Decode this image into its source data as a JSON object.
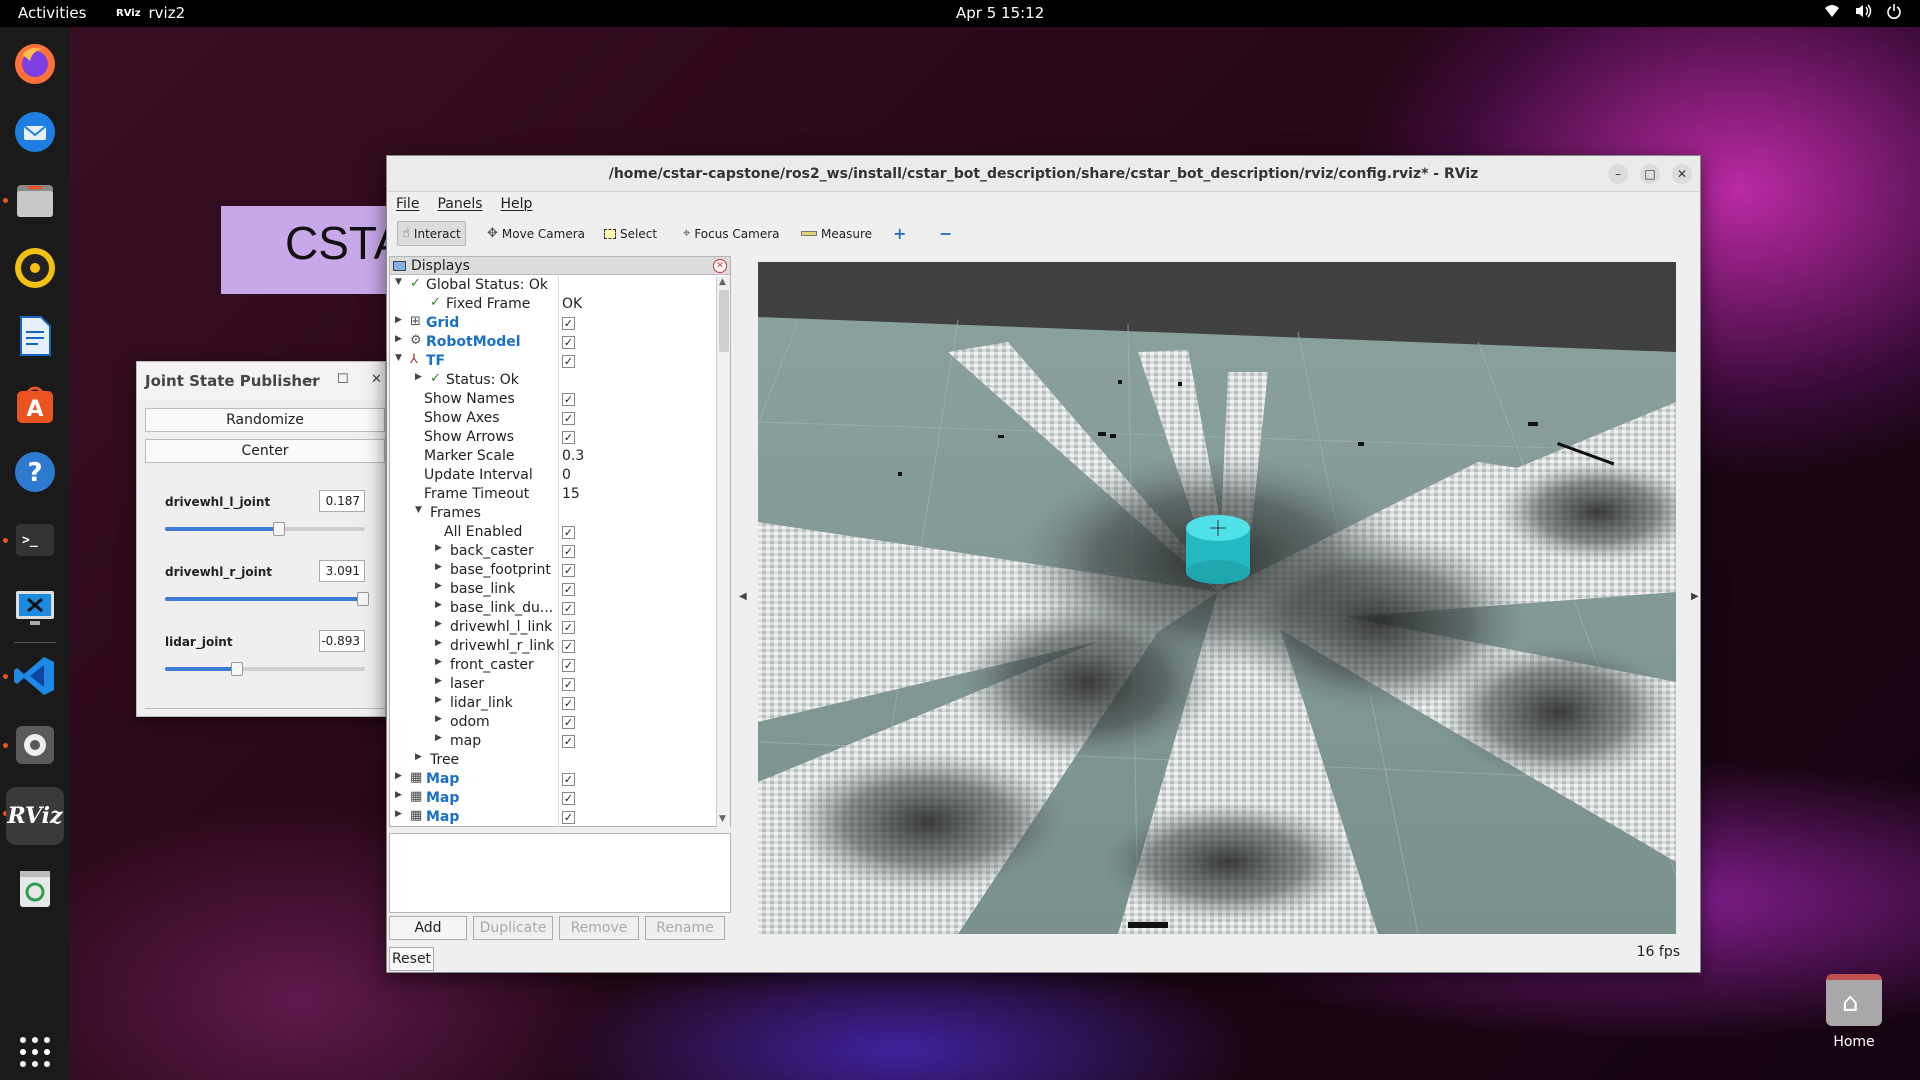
{
  "topbar": {
    "activities": "Activities",
    "app_icon": "RViz",
    "app_name": "rviz2",
    "clock": "Apr 5  15:12",
    "tray_icons": [
      "wifi-icon",
      "volume-icon",
      "power-icon"
    ]
  },
  "dock": {
    "items": [
      "firefox",
      "thunderbird",
      "files",
      "rhythmbox",
      "libreoffice-writer",
      "app-center",
      "help",
      "terminal",
      "remote-desktop",
      "vscode",
      "settings",
      "rviz",
      "trash"
    ],
    "rviz_label": "RViz",
    "terminal_label": ">_"
  },
  "background_card": {
    "text": "CSTA"
  },
  "jsp": {
    "title": "Joint State Publisher",
    "randomize": "Randomize",
    "center": "Center",
    "joints": [
      {
        "name": "drivewhl_l_joint",
        "value": "0.187",
        "slider_fraction": 0.57
      },
      {
        "name": "drivewhl_r_joint",
        "value": "3.091",
        "slider_fraction": 0.99
      },
      {
        "name": "lidar_joint",
        "value": "-0.893",
        "slider_fraction": 0.36
      }
    ]
  },
  "rviz": {
    "title": "/home/cstar-capstone/ros2_ws/install/cstar_bot_description/share/cstar_bot_description/rviz/config.rviz* - RViz",
    "menu": [
      "File",
      "Panels",
      "Help"
    ],
    "tools": {
      "interact": "Interact",
      "move_camera": "Move Camera",
      "select": "Select",
      "focus_camera": "Focus Camera",
      "measure": "Measure",
      "add_icon": "+",
      "remove_icon": "−"
    },
    "displays_title": "Displays",
    "tree": {
      "global_status": "Global Status: Ok",
      "fixed_frame": "Fixed Frame",
      "fixed_frame_value": "OK",
      "grid": "Grid",
      "robot_model": "RobotModel",
      "tf": "TF",
      "status_ok": "Status: Ok",
      "show_names": "Show Names",
      "show_axes": "Show Axes",
      "show_arrows": "Show Arrows",
      "marker_scale": "Marker Scale",
      "marker_scale_value": "0.3",
      "update_interval": "Update Interval",
      "update_interval_value": "0",
      "frame_timeout": "Frame Timeout",
      "frame_timeout_value": "15",
      "frames": "Frames",
      "all_enabled": "All Enabled",
      "frame_list": [
        "back_caster",
        "base_footprint",
        "base_link",
        "base_link_du...",
        "drivewhl_l_link",
        "drivewhl_r_link",
        "front_caster",
        "laser",
        "lidar_link",
        "odom",
        "map"
      ],
      "tree_label": "Tree",
      "map": "Map"
    },
    "buttons": {
      "add": "Add",
      "duplicate": "Duplicate",
      "remove": "Remove",
      "rename": "Rename",
      "reset": "Reset"
    },
    "fps": "16 fps"
  },
  "home": {
    "label": "Home"
  },
  "colors": {
    "accent_orange": "#e95420",
    "rviz_blue": "#1a6fc7",
    "robot_cyan": "#2ec8d2"
  }
}
